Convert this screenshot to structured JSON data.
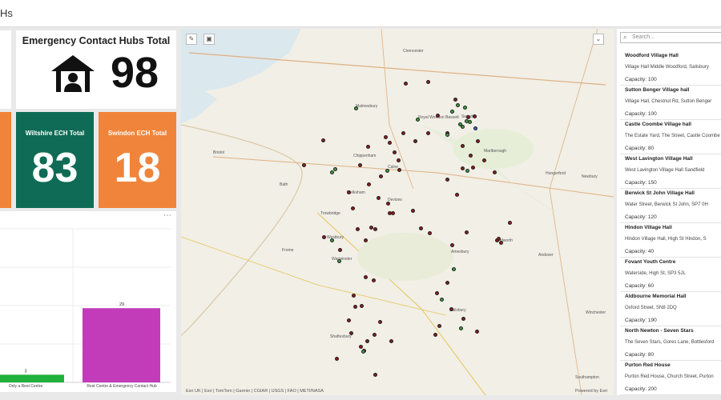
{
  "header": {
    "title": "Hs"
  },
  "summary": {
    "title": "Emergency Contact Hubs Total",
    "value": "98",
    "icon": "house-person-icon"
  },
  "indicators": [
    {
      "label": "Wiltshire ECH Total",
      "value": "83",
      "color": "#0f6b55"
    },
    {
      "label": "Swindon ECH Total",
      "value": "18",
      "color": "#f0843b"
    }
  ],
  "chart_data": {
    "type": "bar",
    "categories": [
      "Only a Rest Centre",
      "Rest Centre & Emergency Contact Hub"
    ],
    "values": [
      3,
      29
    ],
    "colors": [
      "#1fb13c",
      "#c23cba"
    ],
    "data_labels": [
      "3",
      "29"
    ],
    "ylim": [
      0,
      60
    ]
  },
  "map": {
    "attribution": "Esri UK | Esri | TomTom | Garmin | CGIAR | USGS | FAO | METI/NASA",
    "powered": "Powered by Esri",
    "places": [
      {
        "name": "Malmesbury"
      },
      {
        "name": "Royal Wootton Bassett"
      },
      {
        "name": "Swindon"
      },
      {
        "name": "Marlborough"
      },
      {
        "name": "Chippenham"
      },
      {
        "name": "Calne"
      },
      {
        "name": "Melksham"
      },
      {
        "name": "Devizes"
      },
      {
        "name": "Trowbridge"
      },
      {
        "name": "Bath"
      },
      {
        "name": "Bristol"
      },
      {
        "name": "Westbury"
      },
      {
        "name": "Warminster"
      },
      {
        "name": "Salisbury"
      },
      {
        "name": "Shaftesbury"
      },
      {
        "name": "Andover"
      },
      {
        "name": "Newbury"
      },
      {
        "name": "Tidworth"
      },
      {
        "name": "Frome"
      },
      {
        "name": "Cirencester"
      },
      {
        "name": "Hungerford"
      },
      {
        "name": "Amesbury"
      },
      {
        "name": "Winchester"
      },
      {
        "name": "Southampton"
      }
    ]
  },
  "list": {
    "search_placeholder": "Search...",
    "items": [
      {
        "name": "Woodford Village Hall",
        "address": "Village Hall Middle Woodford, Salisbury",
        "capacity": "Capacity: 100"
      },
      {
        "name": "Sutton Benger Village hall",
        "address": "Village Hall, Chestnut Rd, Sutton Benger",
        "capacity": "Capacity: 100"
      },
      {
        "name": "Castle Coombe Village hall",
        "address": "The Estate Yard, The Street, Castle Coombe",
        "capacity": "Capacity: 80"
      },
      {
        "name": "West Lavington Village Hall",
        "address": "West Lavington Village Hall Sandfield",
        "capacity": "Capacity: 150"
      },
      {
        "name": "Berwick St John Village Hall",
        "address": "Water Street, Berwick St John, SP7 0H",
        "capacity": "Capacity: 120"
      },
      {
        "name": "Hindon Village Hall",
        "address": "Hindon Village Hall, High St Hindon, S",
        "capacity": "Capacity: 40"
      },
      {
        "name": "Fovant Youth Centre",
        "address": "Waterside, High St, SP3 5JL",
        "capacity": "Capacity: 60"
      },
      {
        "name": "Aldbourne Memorial Hall",
        "address": "Oxford Street, SN8 2DQ",
        "capacity": "Capacity: 190"
      },
      {
        "name": "North Newton - Seven Stars",
        "address": "The Seven Stars, Gores Lane, Bottlesford",
        "capacity": "Capacity: 80"
      },
      {
        "name": "Purton Red House",
        "address": "Purton Red House, Church Street, Purton",
        "capacity": "Capacity: 200"
      }
    ]
  }
}
